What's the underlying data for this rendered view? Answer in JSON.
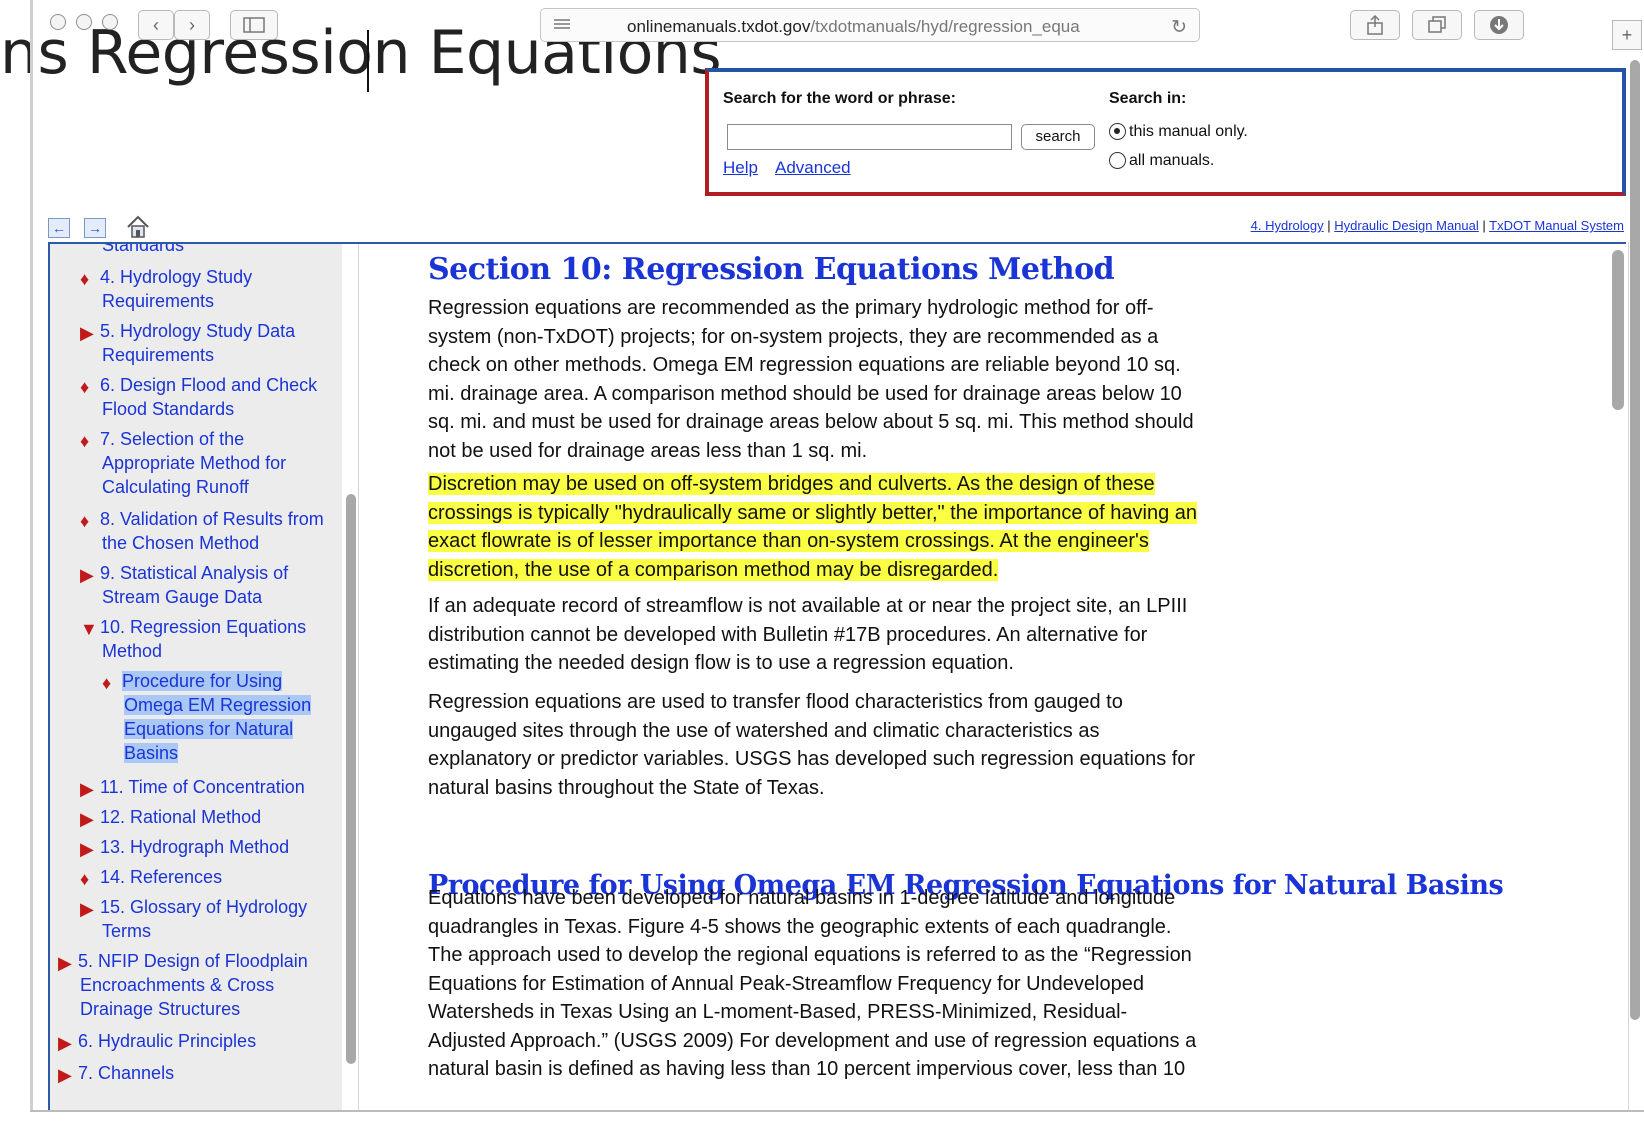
{
  "background": {
    "title": "ns Regression Equations"
  },
  "browser": {
    "url_domain": "onlinemanuals.txdot.gov",
    "url_path": "/txdotmanuals/hyd/regression_equa",
    "new_tab_label": "+"
  },
  "search": {
    "phrase_label": "Search for the word or phrase:",
    "search_in_label": "Search in:",
    "input_value": "",
    "button_label": "search",
    "help_link": "Help",
    "advanced_link": "Advanced",
    "options": [
      "this manual only.",
      "all manuals."
    ],
    "selected_option": "this manual only."
  },
  "breadcrumbs": [
    "4. Hydrology",
    "Hydraulic Design Manual",
    "TxDOT Manual System"
  ],
  "toc": {
    "items": [
      {
        "marker": "",
        "lines": [
          "Standards"
        ]
      },
      {
        "marker": "♦",
        "lines": [
          "4. Hydrology Study",
          "Requirements"
        ]
      },
      {
        "marker": "▶",
        "lines": [
          "5. Hydrology Study Data",
          "Requirements"
        ]
      },
      {
        "marker": "♦",
        "lines": [
          "6. Design Flood and Check",
          "Flood Standards"
        ]
      },
      {
        "marker": "♦",
        "lines": [
          "7. Selection of the",
          "Appropriate Method for",
          "Calculating Runoff"
        ]
      },
      {
        "marker": "♦",
        "lines": [
          "8. Validation of Results from",
          "the Chosen Method"
        ]
      },
      {
        "marker": "▶",
        "lines": [
          "9. Statistical Analysis of",
          "Stream Gauge Data"
        ]
      },
      {
        "marker": "▼",
        "lines": [
          "10. Regression Equations",
          "Method"
        ]
      },
      {
        "marker": "♦",
        "lines": [
          "Procedure for Using",
          "Omega EM Regression",
          "Equations for Natural",
          "Basins"
        ],
        "selected": true
      },
      {
        "marker": "▶",
        "lines": [
          "11. Time of Concentration"
        ]
      },
      {
        "marker": "▶",
        "lines": [
          "12. Rational Method"
        ]
      },
      {
        "marker": "▶",
        "lines": [
          "13. Hydrograph Method"
        ]
      },
      {
        "marker": "♦",
        "lines": [
          "14. References"
        ]
      },
      {
        "marker": "▶",
        "lines": [
          "15. Glossary of Hydrology",
          "Terms"
        ]
      },
      {
        "marker": "▶",
        "lines": [
          "5. NFIP Design of Floodplain",
          "Encroachments & Cross",
          "Drainage Structures"
        ]
      },
      {
        "marker": "▶",
        "lines": [
          "6. Hydraulic Principles"
        ]
      },
      {
        "marker": "▶",
        "lines": [
          "7. Channels"
        ]
      }
    ]
  },
  "content": {
    "heading": "Section 10: Regression Equations Method",
    "p1": [
      "Regression equations are recommended as the primary hydrologic method for off-",
      "system (non-TxDOT) projects; for on-system projects, they are recommended as a",
      "check on other methods. Omega EM regression equations are reliable beyond 10 sq.",
      "mi. drainage area. A comparison method should be used for drainage areas below 10",
      "sq. mi. and must be used for drainage areas below about 5 sq. mi. This method should",
      "not be used for drainage areas less than 1 sq. mi."
    ],
    "p2": [
      "Discretion may be used on off-system bridges and culverts. As the design of these",
      "crossings is typically \"hydraulically same or slightly better,\" the importance of having an",
      "exact flowrate is of lesser importance than on-system crossings. At the engineer's",
      "discretion, the use of a comparison method may be disregarded."
    ],
    "p3": [
      "If an adequate record of streamflow is not available at or near the project site, an LPIII",
      "distribution cannot be developed with Bulletin #17B procedures. An alternative for",
      "estimating the needed design flow is to use a regression equation."
    ],
    "p4": [
      "Regression equations are used to transfer flood characteristics from gauged to",
      "ungauged sites through the use of watershed and climatic characteristics as",
      "explanatory or predictor variables. USGS has developed such regression equations for",
      "natural basins throughout the State of Texas."
    ],
    "subheading": "Procedure for Using Omega EM Regression Equations for Natural Basins",
    "p5": [
      "Equations have been developed for natural basins in 1-degree latitude and longitude",
      "quadrangles in Texas. Figure 4-5 shows the geographic extents of each quadrangle.",
      "The approach used to develop the regional equations is referred to as the “Regression",
      "Equations for Estimation of Annual Peak-Streamflow Frequency for Undeveloped",
      "Watersheds in Texas Using an L-moment-Based, PRESS-Minimized, Residual-",
      "Adjusted Approach.” (USGS 2009) For development and use of regression equations a",
      "natural basin is defined as having less than 10 percent impervious cover, less than 10"
    ]
  }
}
